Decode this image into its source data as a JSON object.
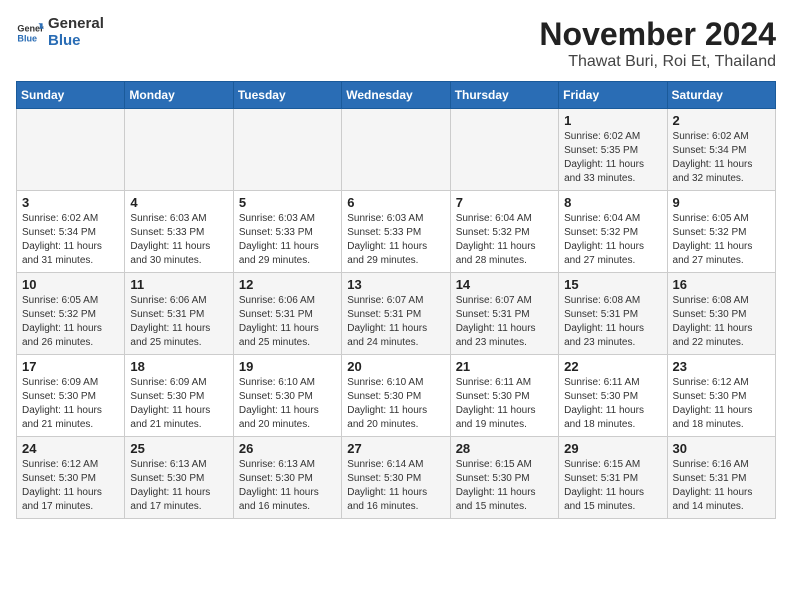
{
  "header": {
    "logo_general": "General",
    "logo_blue": "Blue",
    "month": "November 2024",
    "location": "Thawat Buri, Roi Et, Thailand"
  },
  "weekdays": [
    "Sunday",
    "Monday",
    "Tuesday",
    "Wednesday",
    "Thursday",
    "Friday",
    "Saturday"
  ],
  "weeks": [
    [
      {
        "day": "",
        "info": ""
      },
      {
        "day": "",
        "info": ""
      },
      {
        "day": "",
        "info": ""
      },
      {
        "day": "",
        "info": ""
      },
      {
        "day": "",
        "info": ""
      },
      {
        "day": "1",
        "info": "Sunrise: 6:02 AM\nSunset: 5:35 PM\nDaylight: 11 hours and 33 minutes."
      },
      {
        "day": "2",
        "info": "Sunrise: 6:02 AM\nSunset: 5:34 PM\nDaylight: 11 hours and 32 minutes."
      }
    ],
    [
      {
        "day": "3",
        "info": "Sunrise: 6:02 AM\nSunset: 5:34 PM\nDaylight: 11 hours and 31 minutes."
      },
      {
        "day": "4",
        "info": "Sunrise: 6:03 AM\nSunset: 5:33 PM\nDaylight: 11 hours and 30 minutes."
      },
      {
        "day": "5",
        "info": "Sunrise: 6:03 AM\nSunset: 5:33 PM\nDaylight: 11 hours and 29 minutes."
      },
      {
        "day": "6",
        "info": "Sunrise: 6:03 AM\nSunset: 5:33 PM\nDaylight: 11 hours and 29 minutes."
      },
      {
        "day": "7",
        "info": "Sunrise: 6:04 AM\nSunset: 5:32 PM\nDaylight: 11 hours and 28 minutes."
      },
      {
        "day": "8",
        "info": "Sunrise: 6:04 AM\nSunset: 5:32 PM\nDaylight: 11 hours and 27 minutes."
      },
      {
        "day": "9",
        "info": "Sunrise: 6:05 AM\nSunset: 5:32 PM\nDaylight: 11 hours and 27 minutes."
      }
    ],
    [
      {
        "day": "10",
        "info": "Sunrise: 6:05 AM\nSunset: 5:32 PM\nDaylight: 11 hours and 26 minutes."
      },
      {
        "day": "11",
        "info": "Sunrise: 6:06 AM\nSunset: 5:31 PM\nDaylight: 11 hours and 25 minutes."
      },
      {
        "day": "12",
        "info": "Sunrise: 6:06 AM\nSunset: 5:31 PM\nDaylight: 11 hours and 25 minutes."
      },
      {
        "day": "13",
        "info": "Sunrise: 6:07 AM\nSunset: 5:31 PM\nDaylight: 11 hours and 24 minutes."
      },
      {
        "day": "14",
        "info": "Sunrise: 6:07 AM\nSunset: 5:31 PM\nDaylight: 11 hours and 23 minutes."
      },
      {
        "day": "15",
        "info": "Sunrise: 6:08 AM\nSunset: 5:31 PM\nDaylight: 11 hours and 23 minutes."
      },
      {
        "day": "16",
        "info": "Sunrise: 6:08 AM\nSunset: 5:30 PM\nDaylight: 11 hours and 22 minutes."
      }
    ],
    [
      {
        "day": "17",
        "info": "Sunrise: 6:09 AM\nSunset: 5:30 PM\nDaylight: 11 hours and 21 minutes."
      },
      {
        "day": "18",
        "info": "Sunrise: 6:09 AM\nSunset: 5:30 PM\nDaylight: 11 hours and 21 minutes."
      },
      {
        "day": "19",
        "info": "Sunrise: 6:10 AM\nSunset: 5:30 PM\nDaylight: 11 hours and 20 minutes."
      },
      {
        "day": "20",
        "info": "Sunrise: 6:10 AM\nSunset: 5:30 PM\nDaylight: 11 hours and 20 minutes."
      },
      {
        "day": "21",
        "info": "Sunrise: 6:11 AM\nSunset: 5:30 PM\nDaylight: 11 hours and 19 minutes."
      },
      {
        "day": "22",
        "info": "Sunrise: 6:11 AM\nSunset: 5:30 PM\nDaylight: 11 hours and 18 minutes."
      },
      {
        "day": "23",
        "info": "Sunrise: 6:12 AM\nSunset: 5:30 PM\nDaylight: 11 hours and 18 minutes."
      }
    ],
    [
      {
        "day": "24",
        "info": "Sunrise: 6:12 AM\nSunset: 5:30 PM\nDaylight: 11 hours and 17 minutes."
      },
      {
        "day": "25",
        "info": "Sunrise: 6:13 AM\nSunset: 5:30 PM\nDaylight: 11 hours and 17 minutes."
      },
      {
        "day": "26",
        "info": "Sunrise: 6:13 AM\nSunset: 5:30 PM\nDaylight: 11 hours and 16 minutes."
      },
      {
        "day": "27",
        "info": "Sunrise: 6:14 AM\nSunset: 5:30 PM\nDaylight: 11 hours and 16 minutes."
      },
      {
        "day": "28",
        "info": "Sunrise: 6:15 AM\nSunset: 5:30 PM\nDaylight: 11 hours and 15 minutes."
      },
      {
        "day": "29",
        "info": "Sunrise: 6:15 AM\nSunset: 5:31 PM\nDaylight: 11 hours and 15 minutes."
      },
      {
        "day": "30",
        "info": "Sunrise: 6:16 AM\nSunset: 5:31 PM\nDaylight: 11 hours and 14 minutes."
      }
    ]
  ]
}
